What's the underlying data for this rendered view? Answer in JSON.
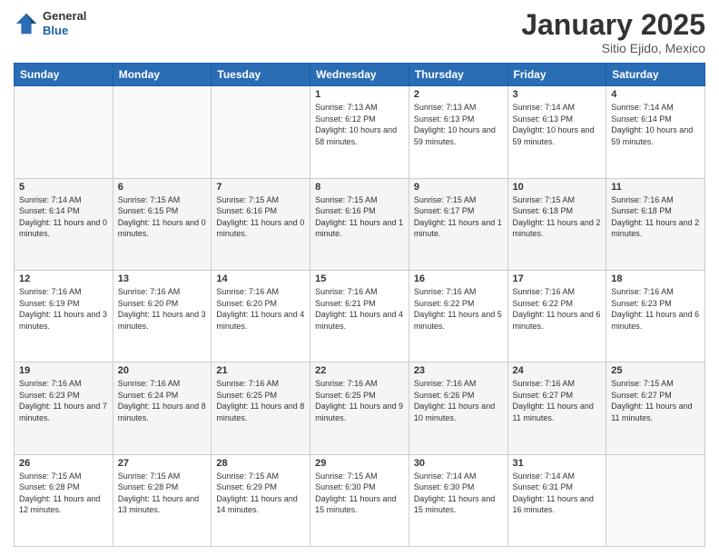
{
  "header": {
    "logo": {
      "general": "General",
      "blue": "Blue"
    },
    "title": "January 2025",
    "subtitle": "Sitio Ejido, Mexico"
  },
  "days_of_week": [
    "Sunday",
    "Monday",
    "Tuesday",
    "Wednesday",
    "Thursday",
    "Friday",
    "Saturday"
  ],
  "weeks": [
    [
      {
        "day": "",
        "info": ""
      },
      {
        "day": "",
        "info": ""
      },
      {
        "day": "",
        "info": ""
      },
      {
        "day": "1",
        "info": "Sunrise: 7:13 AM\nSunset: 6:12 PM\nDaylight: 10 hours and 58 minutes."
      },
      {
        "day": "2",
        "info": "Sunrise: 7:13 AM\nSunset: 6:13 PM\nDaylight: 10 hours and 59 minutes."
      },
      {
        "day": "3",
        "info": "Sunrise: 7:14 AM\nSunset: 6:13 PM\nDaylight: 10 hours and 59 minutes."
      },
      {
        "day": "4",
        "info": "Sunrise: 7:14 AM\nSunset: 6:14 PM\nDaylight: 10 hours and 59 minutes."
      }
    ],
    [
      {
        "day": "5",
        "info": "Sunrise: 7:14 AM\nSunset: 6:14 PM\nDaylight: 11 hours and 0 minutes."
      },
      {
        "day": "6",
        "info": "Sunrise: 7:15 AM\nSunset: 6:15 PM\nDaylight: 11 hours and 0 minutes."
      },
      {
        "day": "7",
        "info": "Sunrise: 7:15 AM\nSunset: 6:16 PM\nDaylight: 11 hours and 0 minutes."
      },
      {
        "day": "8",
        "info": "Sunrise: 7:15 AM\nSunset: 6:16 PM\nDaylight: 11 hours and 1 minute."
      },
      {
        "day": "9",
        "info": "Sunrise: 7:15 AM\nSunset: 6:17 PM\nDaylight: 11 hours and 1 minute."
      },
      {
        "day": "10",
        "info": "Sunrise: 7:15 AM\nSunset: 6:18 PM\nDaylight: 11 hours and 2 minutes."
      },
      {
        "day": "11",
        "info": "Sunrise: 7:16 AM\nSunset: 6:18 PM\nDaylight: 11 hours and 2 minutes."
      }
    ],
    [
      {
        "day": "12",
        "info": "Sunrise: 7:16 AM\nSunset: 6:19 PM\nDaylight: 11 hours and 3 minutes."
      },
      {
        "day": "13",
        "info": "Sunrise: 7:16 AM\nSunset: 6:20 PM\nDaylight: 11 hours and 3 minutes."
      },
      {
        "day": "14",
        "info": "Sunrise: 7:16 AM\nSunset: 6:20 PM\nDaylight: 11 hours and 4 minutes."
      },
      {
        "day": "15",
        "info": "Sunrise: 7:16 AM\nSunset: 6:21 PM\nDaylight: 11 hours and 4 minutes."
      },
      {
        "day": "16",
        "info": "Sunrise: 7:16 AM\nSunset: 6:22 PM\nDaylight: 11 hours and 5 minutes."
      },
      {
        "day": "17",
        "info": "Sunrise: 7:16 AM\nSunset: 6:22 PM\nDaylight: 11 hours and 6 minutes."
      },
      {
        "day": "18",
        "info": "Sunrise: 7:16 AM\nSunset: 6:23 PM\nDaylight: 11 hours and 6 minutes."
      }
    ],
    [
      {
        "day": "19",
        "info": "Sunrise: 7:16 AM\nSunset: 6:23 PM\nDaylight: 11 hours and 7 minutes."
      },
      {
        "day": "20",
        "info": "Sunrise: 7:16 AM\nSunset: 6:24 PM\nDaylight: 11 hours and 8 minutes."
      },
      {
        "day": "21",
        "info": "Sunrise: 7:16 AM\nSunset: 6:25 PM\nDaylight: 11 hours and 8 minutes."
      },
      {
        "day": "22",
        "info": "Sunrise: 7:16 AM\nSunset: 6:25 PM\nDaylight: 11 hours and 9 minutes."
      },
      {
        "day": "23",
        "info": "Sunrise: 7:16 AM\nSunset: 6:26 PM\nDaylight: 11 hours and 10 minutes."
      },
      {
        "day": "24",
        "info": "Sunrise: 7:16 AM\nSunset: 6:27 PM\nDaylight: 11 hours and 11 minutes."
      },
      {
        "day": "25",
        "info": "Sunrise: 7:15 AM\nSunset: 6:27 PM\nDaylight: 11 hours and 11 minutes."
      }
    ],
    [
      {
        "day": "26",
        "info": "Sunrise: 7:15 AM\nSunset: 6:28 PM\nDaylight: 11 hours and 12 minutes."
      },
      {
        "day": "27",
        "info": "Sunrise: 7:15 AM\nSunset: 6:28 PM\nDaylight: 11 hours and 13 minutes."
      },
      {
        "day": "28",
        "info": "Sunrise: 7:15 AM\nSunset: 6:29 PM\nDaylight: 11 hours and 14 minutes."
      },
      {
        "day": "29",
        "info": "Sunrise: 7:15 AM\nSunset: 6:30 PM\nDaylight: 11 hours and 15 minutes."
      },
      {
        "day": "30",
        "info": "Sunrise: 7:14 AM\nSunset: 6:30 PM\nDaylight: 11 hours and 15 minutes."
      },
      {
        "day": "31",
        "info": "Sunrise: 7:14 AM\nSunset: 6:31 PM\nDaylight: 11 hours and 16 minutes."
      },
      {
        "day": "",
        "info": ""
      }
    ]
  ]
}
